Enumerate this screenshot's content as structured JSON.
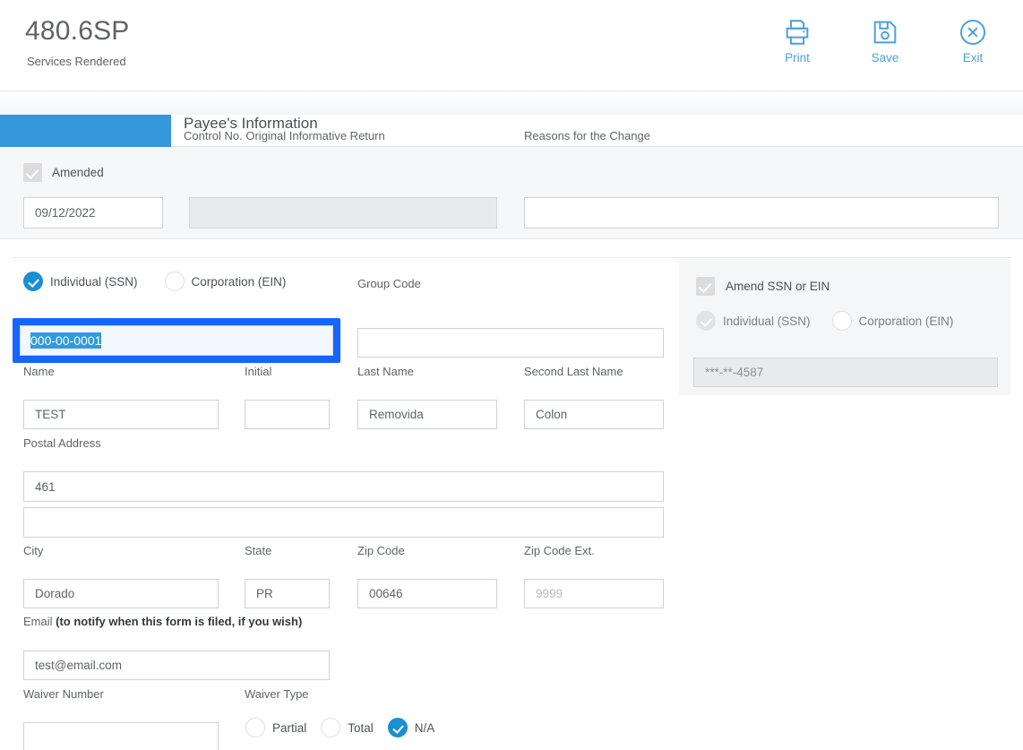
{
  "header": {
    "form_id": "480.6SP",
    "form_subtitle": "Services Rendered",
    "actions": [
      {
        "name": "print",
        "label": "Print",
        "icon": "printer-icon"
      },
      {
        "name": "save",
        "label": "Save",
        "icon": "floppy-disk-icon"
      },
      {
        "name": "exit",
        "label": "Exit",
        "icon": "close-circle-icon"
      }
    ],
    "accent_color": "#4a9fe0"
  },
  "tabs": {
    "active_tab_label": "",
    "active_tab_color": "#3498db",
    "panel_title": "Payee's Information"
  },
  "columns": {
    "control_no": "Control No. Original Informative Return",
    "reasons_for_change": "Reasons for the Change"
  },
  "amended_band": {
    "checkbox_label": "Amended",
    "checkbox_checked": true,
    "checkbox_disabled": true,
    "date_value": "09/12/2022",
    "control_no_value": "",
    "control_no_disabled": true,
    "reasons_value": ""
  },
  "payee": {
    "entity_type": {
      "options": [
        {
          "label": "Individual (SSN)",
          "selected": true
        },
        {
          "label": "Corporation (EIN)",
          "selected": false
        }
      ]
    },
    "ssn": {
      "value": "000-00-0001",
      "selected_text": "000-00-0001",
      "focused": true,
      "focus_color": "#1565ff"
    },
    "group_code": {
      "label": "Group Code",
      "value": ""
    },
    "name": {
      "label": "Name",
      "value": "TEST"
    },
    "initial": {
      "label": "Initial",
      "value": ""
    },
    "last_name": {
      "label": "Last Name",
      "value": "Removida"
    },
    "second_last_name": {
      "label": "Second Last Name",
      "value": "Colon"
    },
    "postal_address": {
      "label": "Postal Address",
      "line1": "461",
      "line2": ""
    },
    "city": {
      "label": "City",
      "value": "Dorado"
    },
    "state": {
      "label": "State",
      "value": "PR"
    },
    "zip_code": {
      "label": "Zip Code",
      "value": "00646"
    },
    "zip_code_ext": {
      "label": "Zip Code Ext.",
      "value": "",
      "placeholder": "9999"
    },
    "email": {
      "label_plain": "Email ",
      "label_bold": "(to notify when this form is filed, if you wish)",
      "value": "test@email.com"
    },
    "waiver_number": {
      "label": "Waiver Number",
      "value": ""
    },
    "waiver_type": {
      "label": "Waiver Type",
      "options": [
        {
          "label": "Partial",
          "selected": false
        },
        {
          "label": "Total",
          "selected": false
        },
        {
          "label": "N/A",
          "selected": true
        }
      ]
    }
  },
  "amend_panel": {
    "checkbox_label": "Amend SSN or EIN",
    "checkbox_checked": true,
    "checkbox_disabled": true,
    "entity_options": [
      {
        "label": "Individual (SSN)",
        "selected": true
      },
      {
        "label": "Corporation (EIN)",
        "selected": false
      }
    ],
    "masked_id": "***-**-4587",
    "disabled": true
  }
}
